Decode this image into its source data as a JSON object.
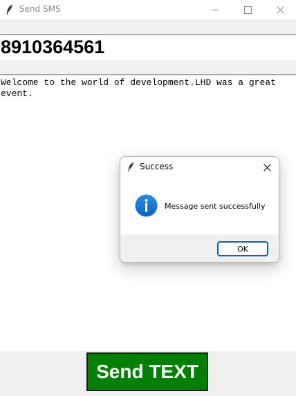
{
  "window": {
    "title": "Send SMS",
    "controls": {
      "minimize_icon": "minimize-icon",
      "maximize_icon": "maximize-icon",
      "close_icon": "close-icon"
    }
  },
  "form": {
    "phone_number": "8910364561",
    "message": "Welcome to the world of development.LHD was a great event.",
    "send_label": "Send TEXT"
  },
  "dialog": {
    "title": "Success",
    "message": "Message sent successfully",
    "ok_label": "OK",
    "icon": "info-icon"
  },
  "colors": {
    "send_button_bg": "#008000",
    "send_button_text": "#ffffff",
    "info_icon": "#0a74d8",
    "ok_button_border": "#0067c0"
  }
}
